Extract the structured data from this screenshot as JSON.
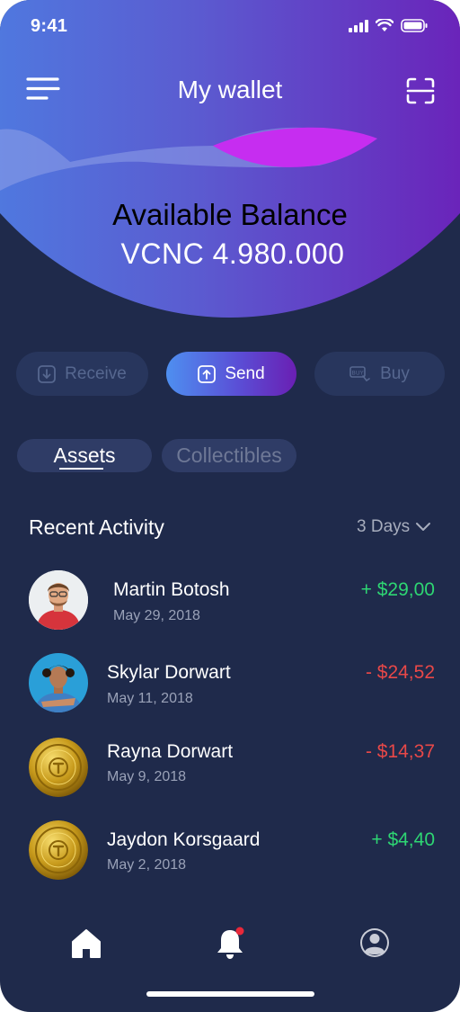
{
  "status_bar": {
    "time": "9:41"
  },
  "header": {
    "title": "My wallet"
  },
  "balance": {
    "label": "Available Balance",
    "value": "VCNC 4.980.000"
  },
  "actions": {
    "receive": "Receive",
    "send": "Send",
    "buy": "Buy"
  },
  "tabs": {
    "assets": "Assets",
    "collectibles": "Collectibles"
  },
  "activity": {
    "title": "Recent Activity",
    "filter": "3 Days",
    "items": [
      {
        "name": "Martin Botosh",
        "date": "May 29, 2018",
        "amount": "+ $29,00",
        "type": "positive",
        "avatar": "person-red-shirt"
      },
      {
        "name": "Skylar Dorwart",
        "date": "May 11, 2018",
        "amount": "- $24,52",
        "type": "negative",
        "avatar": "person-blue-shirt"
      },
      {
        "name": "Rayna Dorwart",
        "date": "May 9, 2018",
        "amount": "- $14,37",
        "type": "negative",
        "avatar": "gold-coin"
      },
      {
        "name": "Jaydon Korsgaard",
        "date": "May 2, 2018",
        "amount": "+ $4,40",
        "type": "positive",
        "avatar": "gold-coin"
      }
    ]
  },
  "colors": {
    "background": "#1f2a4b",
    "accent_gradient_start": "#4a86e6",
    "accent_gradient_end": "#6a1fb3",
    "positive": "#2ed673",
    "negative": "#e84848",
    "notification_dot": "#e8283a"
  },
  "bottom_nav": {
    "items": [
      "home-icon",
      "bell-icon",
      "profile-icon"
    ]
  }
}
